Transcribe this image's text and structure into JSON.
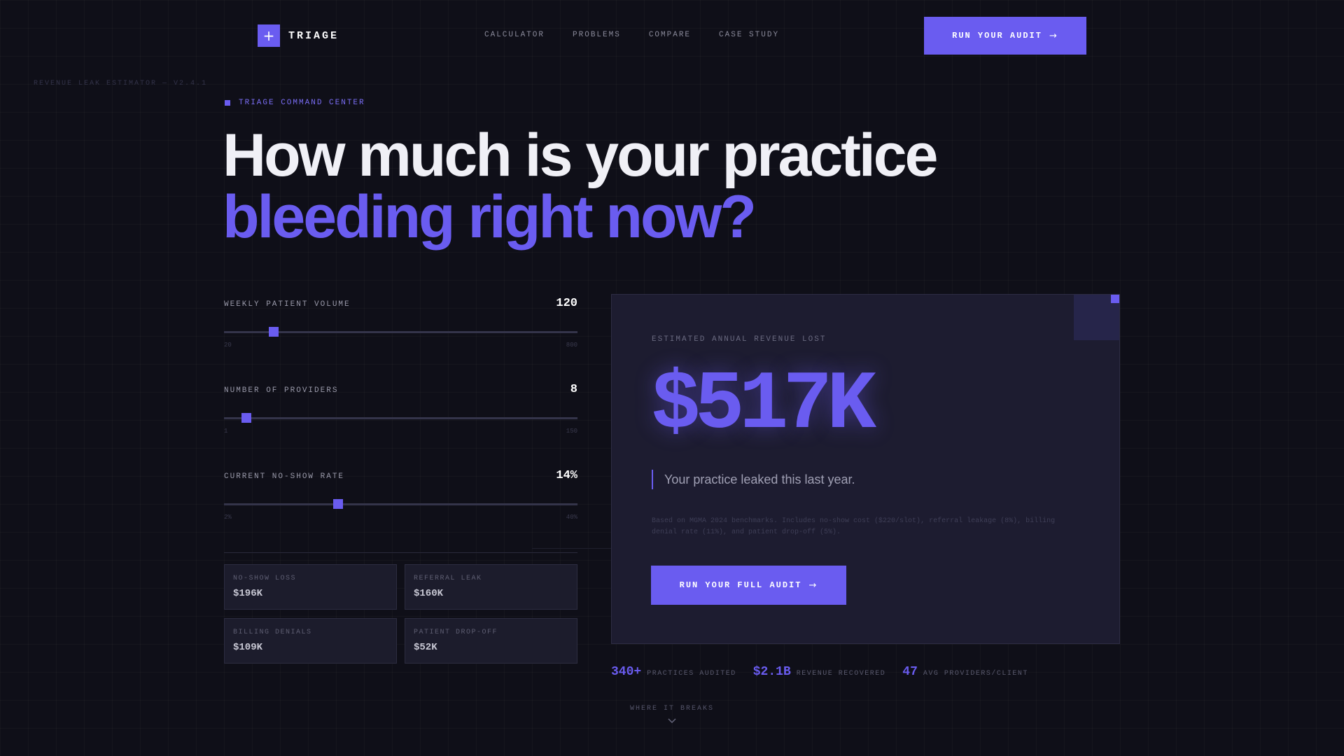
{
  "brand": {
    "name": "TRIAGE",
    "logo_glyph": "+"
  },
  "nav": {
    "links": [
      "CALCULATOR",
      "PROBLEMS",
      "COMPARE",
      "CASE STUDY"
    ],
    "cta_label": "RUN YOUR AUDIT"
  },
  "version_label": "REVENUE LEAK ESTIMATOR — V2.4.1",
  "eyebrow": "TRIAGE COMMAND CENTER",
  "headline": {
    "line1": "How much is your practice",
    "line2": "bleeding right now?"
  },
  "sliders": [
    {
      "label": "WEEKLY PATIENT VOLUME",
      "value_display": "120",
      "min_label": "20",
      "max_label": "800",
      "fill_fraction": 0.14
    },
    {
      "label": "NUMBER OF PROVIDERS",
      "value_display": "8",
      "min_label": "1",
      "max_label": "150",
      "fill_fraction": 0.063
    },
    {
      "label": "CURRENT NO-SHOW RATE",
      "value_display": "14%",
      "min_label": "2%",
      "max_label": "40%",
      "fill_fraction": 0.323
    }
  ],
  "metrics": [
    {
      "label": "NO-SHOW LOSS",
      "value": "$196K"
    },
    {
      "label": "REFERRAL LEAK",
      "value": "$160K"
    },
    {
      "label": "BILLING DENIALS",
      "value": "$109K"
    },
    {
      "label": "PATIENT DROP-OFF",
      "value": "$52K"
    }
  ],
  "result": {
    "label": "ESTIMATED ANNUAL REVENUE LOST",
    "value": "$517K",
    "subtitle": "Your practice leaked this last year.",
    "footnote": "Based on MGMA 2024 benchmarks. Includes no-show cost ($220/slot), referral leakage (8%), billing denial rate (11%), and patient drop-off (5%).",
    "cta_label": "RUN YOUR FULL AUDIT"
  },
  "stats": [
    {
      "value": "340+",
      "label": "PRACTICES AUDITED"
    },
    {
      "value": "$2.1B",
      "label": "REVENUE RECOVERED"
    },
    {
      "value": "47",
      "label": "AVG PROVIDERS/CLIENT"
    }
  ],
  "scroll_hint": "WHERE IT BREAKS",
  "colors": {
    "accent": "#6a5cf0",
    "background": "#0f0f18",
    "card": "#1d1c30"
  },
  "icons": {
    "logo": "plus-icon",
    "cta": "arrow-right-icon",
    "scroll": "chevron-down-icon"
  }
}
